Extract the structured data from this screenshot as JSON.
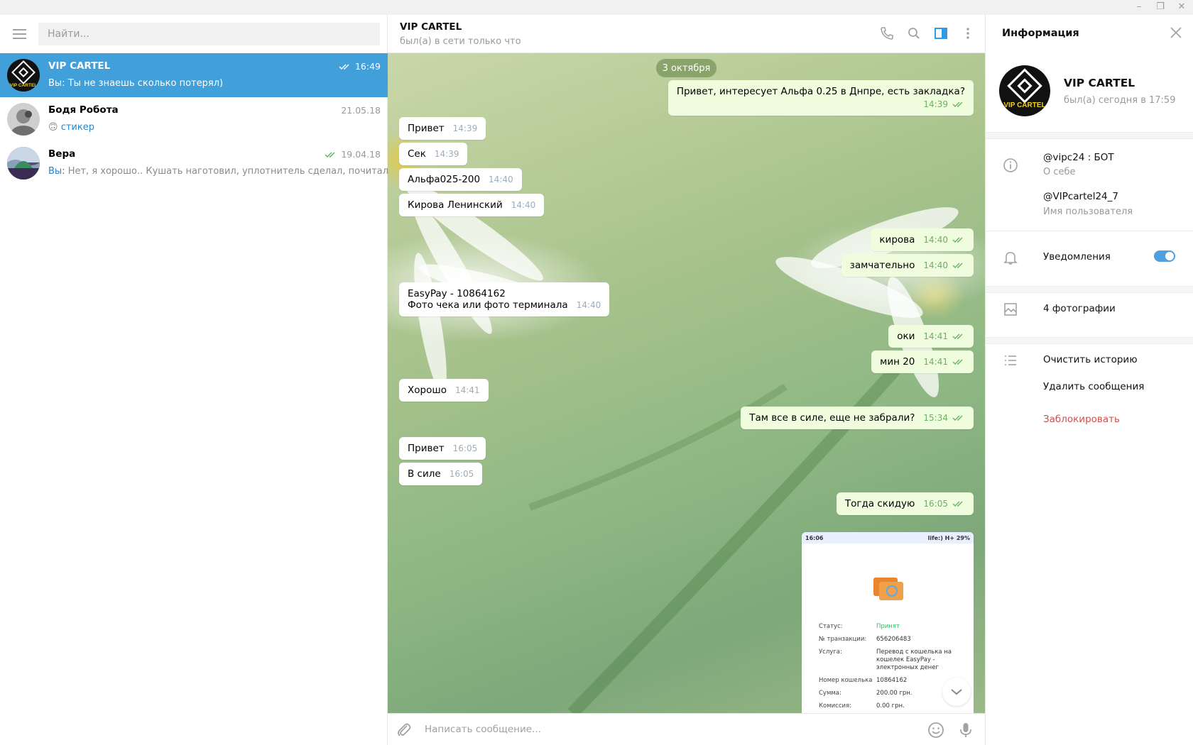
{
  "sidebar": {
    "search_placeholder": "Найти...",
    "dialogs": [
      {
        "name": "VIP CARTEL",
        "time": "16:49",
        "prefix": "Вы:",
        "message": "Ты не знаешь сколько потерял)",
        "active": true
      },
      {
        "name": "Бодя Робота",
        "time": "21.05.18",
        "emoji": "🙃",
        "message": "стикер"
      },
      {
        "name": "Вера",
        "time": "19.04.18",
        "prefix": "Вы:",
        "message": "Нет, я хорошо.. Кушать наготовил, уплотнитель сделал, почитал"
      }
    ]
  },
  "chat": {
    "title": "VIP CARTEL",
    "status": "был(а) в сети только что",
    "date": "3 октября",
    "messages": [
      {
        "dir": "out",
        "text": "Привет, интересует Альфа 0.25 в Днпре, есть закладка?",
        "time": "14:39"
      },
      {
        "dir": "in",
        "text": "Привет",
        "time": "14:39"
      },
      {
        "dir": "in",
        "text": "Сек",
        "time": "14:39"
      },
      {
        "dir": "in",
        "text": "Альфа025-200",
        "time": "14:40"
      },
      {
        "dir": "in",
        "text": "Кирова Ленинский",
        "time": "14:40"
      },
      {
        "dir": "out",
        "text": "кирова",
        "time": "14:40"
      },
      {
        "dir": "out",
        "text": "замчательно",
        "time": "14:40"
      },
      {
        "dir": "in",
        "text_line1": "EasyPay - 10864162",
        "text_line2": "Фото чека или фото терминала",
        "time": "14:40"
      },
      {
        "dir": "out",
        "text": "оки",
        "time": "14:41"
      },
      {
        "dir": "out",
        "text": "мин 20",
        "time": "14:41"
      },
      {
        "dir": "in",
        "text": "Хорошо",
        "time": "14:41"
      },
      {
        "dir": "out",
        "text": "Там все в силе, еще не забрали?",
        "time": "15:34"
      },
      {
        "dir": "in",
        "text": "Привет",
        "time": "16:05"
      },
      {
        "dir": "in",
        "text": "В силе",
        "time": "16:05"
      },
      {
        "dir": "out",
        "text": "Тогда скидую",
        "time": "16:05"
      }
    ],
    "receipt": {
      "status_time": "16:06",
      "status_right": "life:) H+ 29%",
      "rows": [
        {
          "k": "Статус:",
          "v": "Принят"
        },
        {
          "k": "№ транзакции:",
          "v": "656206483"
        },
        {
          "k": "Услуга:",
          "v": "Перевод с кошелька на кошелек EasyPay - электронных денег"
        },
        {
          "k": "Номер кошелька",
          "v": "10864162"
        },
        {
          "k": "Сумма:",
          "v": "200.00 грн."
        },
        {
          "k": "Комиссия:",
          "v": "0.00 грн."
        }
      ]
    },
    "compose_placeholder": "Написать сообщение..."
  },
  "panel": {
    "title": "Информация",
    "name": "VIP CARTEL",
    "status": "был(а) сегодня в 17:59",
    "bio": "@vipc24 : БОТ",
    "bio_hint": "О себе",
    "username": "@VIPcartel24_7",
    "username_hint": "Имя пользователя",
    "notifications": "Уведомления",
    "notifications_on": true,
    "photos": "4 фотографии",
    "clear_history": "Очистить историю",
    "delete_messages": "Удалить сообщения",
    "block": "Заблокировать",
    "avatar_text": "VIP CARTEL"
  },
  "colors": {
    "accent": "#419fd9",
    "out_bubble": "#effdde",
    "check_green": "#6cb160",
    "danger": "#d14e4e"
  }
}
